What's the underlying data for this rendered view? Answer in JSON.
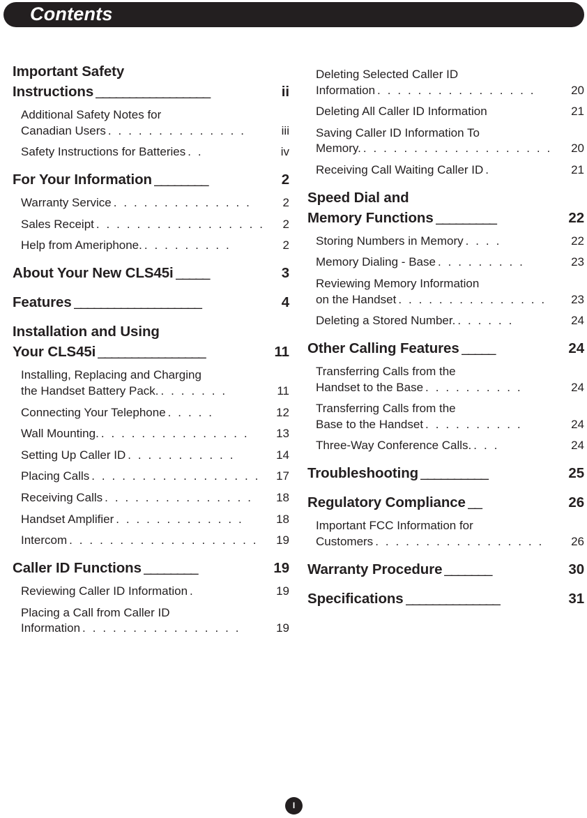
{
  "header": {
    "title": "Contents",
    "bar_color": "#231f20",
    "text_color": "#ffffff"
  },
  "folio": {
    "page_label": "I"
  },
  "toc": {
    "left_column": [
      {
        "type": "heading",
        "lines": [
          "Important Safety",
          "Instructions"
        ],
        "leader": "_________________",
        "page": "ii"
      },
      {
        "type": "sub",
        "lines": [
          "Additional Safety Notes for",
          "Canadian Users"
        ],
        "leader": ". . . . . . . . . . . . . .",
        "page": "iii"
      },
      {
        "type": "sub",
        "lines": [
          "Safety Instructions for Batteries"
        ],
        "leader": ". .",
        "page": "iv"
      },
      {
        "type": "heading",
        "lines": [
          "For Your Information"
        ],
        "leader": "________",
        "page": "2"
      },
      {
        "type": "sub",
        "lines": [
          "Warranty Service"
        ],
        "leader": ". . . . . . . . . . . . . .",
        "page": "2"
      },
      {
        "type": "sub",
        "lines": [
          "Sales Receipt"
        ],
        "leader": ". . . . . . . . . . . . . . . . .",
        "page": "2"
      },
      {
        "type": "sub",
        "lines": [
          "Help from Ameriphone."
        ],
        "leader": ". . . . . . . . .",
        "page": "2"
      },
      {
        "type": "heading",
        "lines": [
          "About Your New CLS45i"
        ],
        "leader": "_____",
        "page": "3"
      },
      {
        "type": "heading",
        "lines": [
          "Features"
        ],
        "leader": "___________________",
        "page": "4"
      },
      {
        "type": "heading",
        "lines": [
          "Installation and Using",
          "Your CLS45i"
        ],
        "leader": "________________",
        "page": "11"
      },
      {
        "type": "sub",
        "lines": [
          "Installing, Replacing and Charging",
          "the Handset Battery Pack."
        ],
        "leader": ". . . . . . .",
        "page": "11"
      },
      {
        "type": "sub",
        "lines": [
          "Connecting Your Telephone"
        ],
        "leader": ". . . . .",
        "page": "12"
      },
      {
        "type": "sub",
        "lines": [
          "Wall Mounting."
        ],
        "leader": ". . . . . . . . . . . . . . .",
        "page": "13"
      },
      {
        "type": "sub",
        "lines": [
          "Setting Up Caller ID"
        ],
        "leader": ". . . . . . . . . . .",
        "page": "14"
      },
      {
        "type": "sub",
        "lines": [
          "Placing Calls"
        ],
        "leader": ". . . . . . . . . . . . . . . . .",
        "page": "17"
      },
      {
        "type": "sub",
        "lines": [
          "Receiving Calls"
        ],
        "leader": ". . . . . . . . . . . . . . .",
        "page": "18"
      },
      {
        "type": "sub",
        "lines": [
          "Handset Amplifier"
        ],
        "leader": ". . . . . . . . . . . . .",
        "page": "18"
      },
      {
        "type": "sub",
        "lines": [
          "Intercom"
        ],
        "leader": ". . . . . . . . . . . . . . . . . . .",
        "page": "19"
      },
      {
        "type": "heading",
        "lines": [
          "Caller ID Functions"
        ],
        "leader": "________",
        "page": "19"
      },
      {
        "type": "sub",
        "lines": [
          "Reviewing Caller ID Information"
        ],
        "leader": ".",
        "page": "19"
      },
      {
        "type": "sub",
        "lines": [
          "Placing a Call from Caller ID",
          "Information"
        ],
        "leader": ". . . . . . . . . . . . . . . .",
        "page": "19"
      }
    ],
    "right_column": [
      {
        "type": "sub",
        "lines": [
          "Deleting Selected Caller ID",
          "Information"
        ],
        "leader": ". . . . . . . . . . . . . . . .",
        "page": "20"
      },
      {
        "type": "sub",
        "lines": [
          "Deleting All Caller ID Information"
        ],
        "leader": "",
        "page": "21"
      },
      {
        "type": "sub",
        "lines": [
          "Saving Caller ID Information To",
          "Memory."
        ],
        "leader": ". . . . . . . . . . . . . . . . . . .",
        "page": "20"
      },
      {
        "type": "sub",
        "lines": [
          "Receiving Call Waiting Caller ID"
        ],
        "leader": ".",
        "page": "21"
      },
      {
        "type": "heading",
        "lines": [
          "Speed Dial and",
          "Memory Functions"
        ],
        "leader": "_________",
        "page": "22"
      },
      {
        "type": "sub",
        "lines": [
          "Storing Numbers in Memory"
        ],
        "leader": ". . . .",
        "page": "22"
      },
      {
        "type": "sub",
        "lines": [
          "Memory Dialing - Base"
        ],
        "leader": ". . . . . . . . .",
        "page": "23"
      },
      {
        "type": "sub",
        "lines": [
          "Reviewing Memory Information",
          "on the Handset"
        ],
        "leader": ". . . . . . . . . . . . . . .",
        "page": "23"
      },
      {
        "type": "sub",
        "lines": [
          "Deleting a Stored Number."
        ],
        "leader": ". . . . . .",
        "page": "24"
      },
      {
        "type": "heading",
        "lines": [
          "Other Calling Features"
        ],
        "leader": "_____",
        "page": "24"
      },
      {
        "type": "sub",
        "lines": [
          "Transferring Calls from the",
          "Handset to the Base"
        ],
        "leader": ". . . . . . . . . .",
        "page": "24"
      },
      {
        "type": "sub",
        "lines": [
          "Transferring Calls from the",
          "Base to the Handset"
        ],
        "leader": ". . . . . . . . . .",
        "page": "24"
      },
      {
        "type": "sub",
        "lines": [
          "Three-Way Conference Calls."
        ],
        "leader": ". . .",
        "page": "24"
      },
      {
        "type": "heading",
        "lines": [
          "Troubleshooting"
        ],
        "leader": "__________",
        "page": "25"
      },
      {
        "type": "heading",
        "lines": [
          "Regulatory Compliance"
        ],
        "leader": "__",
        "page": "26"
      },
      {
        "type": "sub",
        "lines": [
          "Important FCC Information for",
          "Customers"
        ],
        "leader": ". . . . . . . . . . . . . . . . .",
        "page": "26"
      },
      {
        "type": "heading",
        "lines": [
          "Warranty Procedure"
        ],
        "leader": "_______",
        "page": "30"
      },
      {
        "type": "heading",
        "lines": [
          "Specifications"
        ],
        "leader": "______________",
        "page": "31"
      }
    ]
  }
}
